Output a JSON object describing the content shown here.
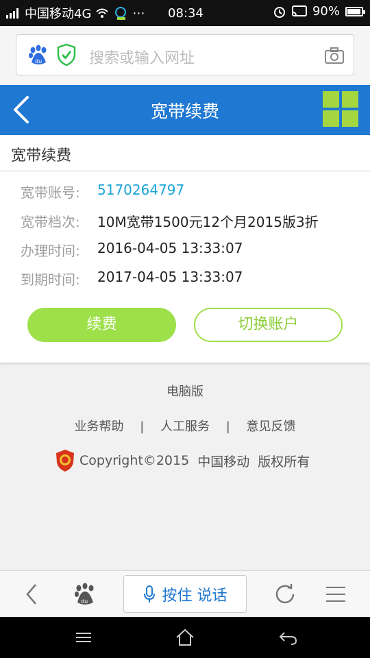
{
  "status_bar": {
    "carrier": "中国移动4G",
    "time": "08:34",
    "battery": "90%"
  },
  "browser": {
    "search_placeholder": "搜索或输入网址",
    "voice_label": "按住 说话"
  },
  "header": {
    "title": "宽带续费"
  },
  "card": {
    "title": "宽带续费",
    "rows": [
      {
        "label": "宽带账号:",
        "value": "5170264797"
      },
      {
        "label": "宽带档次:",
        "value": "10M宽带1500元12个月2015版3折"
      },
      {
        "label": "办理时间:",
        "value": "2016-04-05 13:33:07"
      },
      {
        "label": "到期时间:",
        "value": "2017-04-05 13:33:07"
      }
    ],
    "renew_button": "续费",
    "switch_button": "切换账户"
  },
  "footer": {
    "pc_version": "电脑版",
    "links": [
      "业务帮助",
      "人工服务",
      "意见反馈"
    ],
    "separator": "|",
    "copyright": "Copyright©2015",
    "company": "中国移动",
    "rights": "版权所有"
  },
  "colors": {
    "header_blue": "#1f78d1",
    "accent_green": "#9de04a",
    "link_blue": "#1aa4d8"
  }
}
